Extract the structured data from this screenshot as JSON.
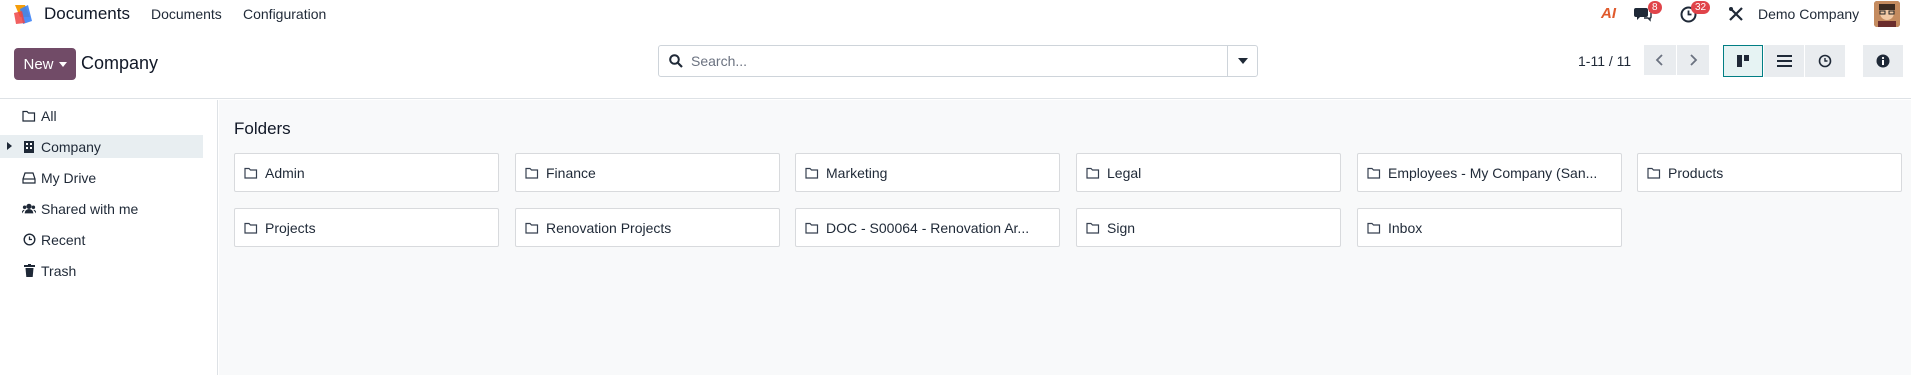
{
  "app": {
    "title": "Documents"
  },
  "nav": {
    "items": [
      "Documents",
      "Configuration"
    ]
  },
  "systray": {
    "ai_label": "AI",
    "messages_count": "8",
    "activities_count": "32",
    "company": "Demo Company"
  },
  "control": {
    "new_label": "New",
    "breadcrumb": "Company",
    "search_placeholder": "Search...",
    "pager": "1-11 / 11"
  },
  "sidebar": {
    "items": [
      {
        "label": "All",
        "icon": "folder-icon"
      },
      {
        "label": "Company",
        "icon": "building-icon"
      },
      {
        "label": "My Drive",
        "icon": "drive-icon"
      },
      {
        "label": "Shared with me",
        "icon": "users-icon"
      },
      {
        "label": "Recent",
        "icon": "clock-icon"
      },
      {
        "label": "Trash",
        "icon": "trash-icon"
      }
    ]
  },
  "main": {
    "section_title": "Folders",
    "folders": [
      "Admin",
      "Finance",
      "Marketing",
      "Legal",
      "Employees - My Company (San...",
      "Products",
      "Projects",
      "Renovation Projects",
      "DOC - S00064 - Renovation Ar...",
      "Sign",
      "Inbox"
    ]
  },
  "colors": {
    "brand": "#714b67",
    "accent": "#017e84",
    "badge": "#e0444a"
  }
}
